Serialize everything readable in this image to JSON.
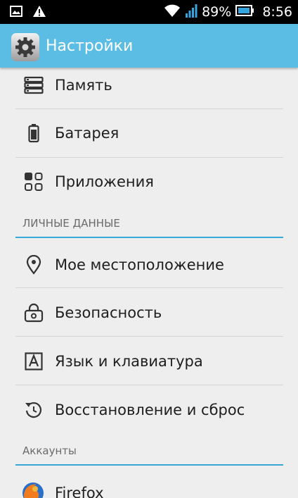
{
  "status_bar": {
    "battery_percent": "89%",
    "time": "8:56",
    "icons": [
      "image-icon",
      "warning-icon",
      "wifi-icon",
      "signal-icon",
      "battery-icon"
    ]
  },
  "action_bar": {
    "title": "Настройки",
    "icon": "settings-gear-icon"
  },
  "items": {
    "memory": "Память",
    "battery": "Батарея",
    "apps": "Приложения",
    "location": "Мое местоположение",
    "security": "Безопасность",
    "language": "Язык и клавиатура",
    "backup": "Восстановление и сброс",
    "firefox": "Firefox"
  },
  "sections": {
    "personal": "ЛИЧНЫЕ ДАННЫЕ",
    "accounts": "Аккаунты"
  },
  "colors": {
    "action_bar": "#5bbde4",
    "section_line": "#36a9d9",
    "background": "#eeeeee"
  }
}
